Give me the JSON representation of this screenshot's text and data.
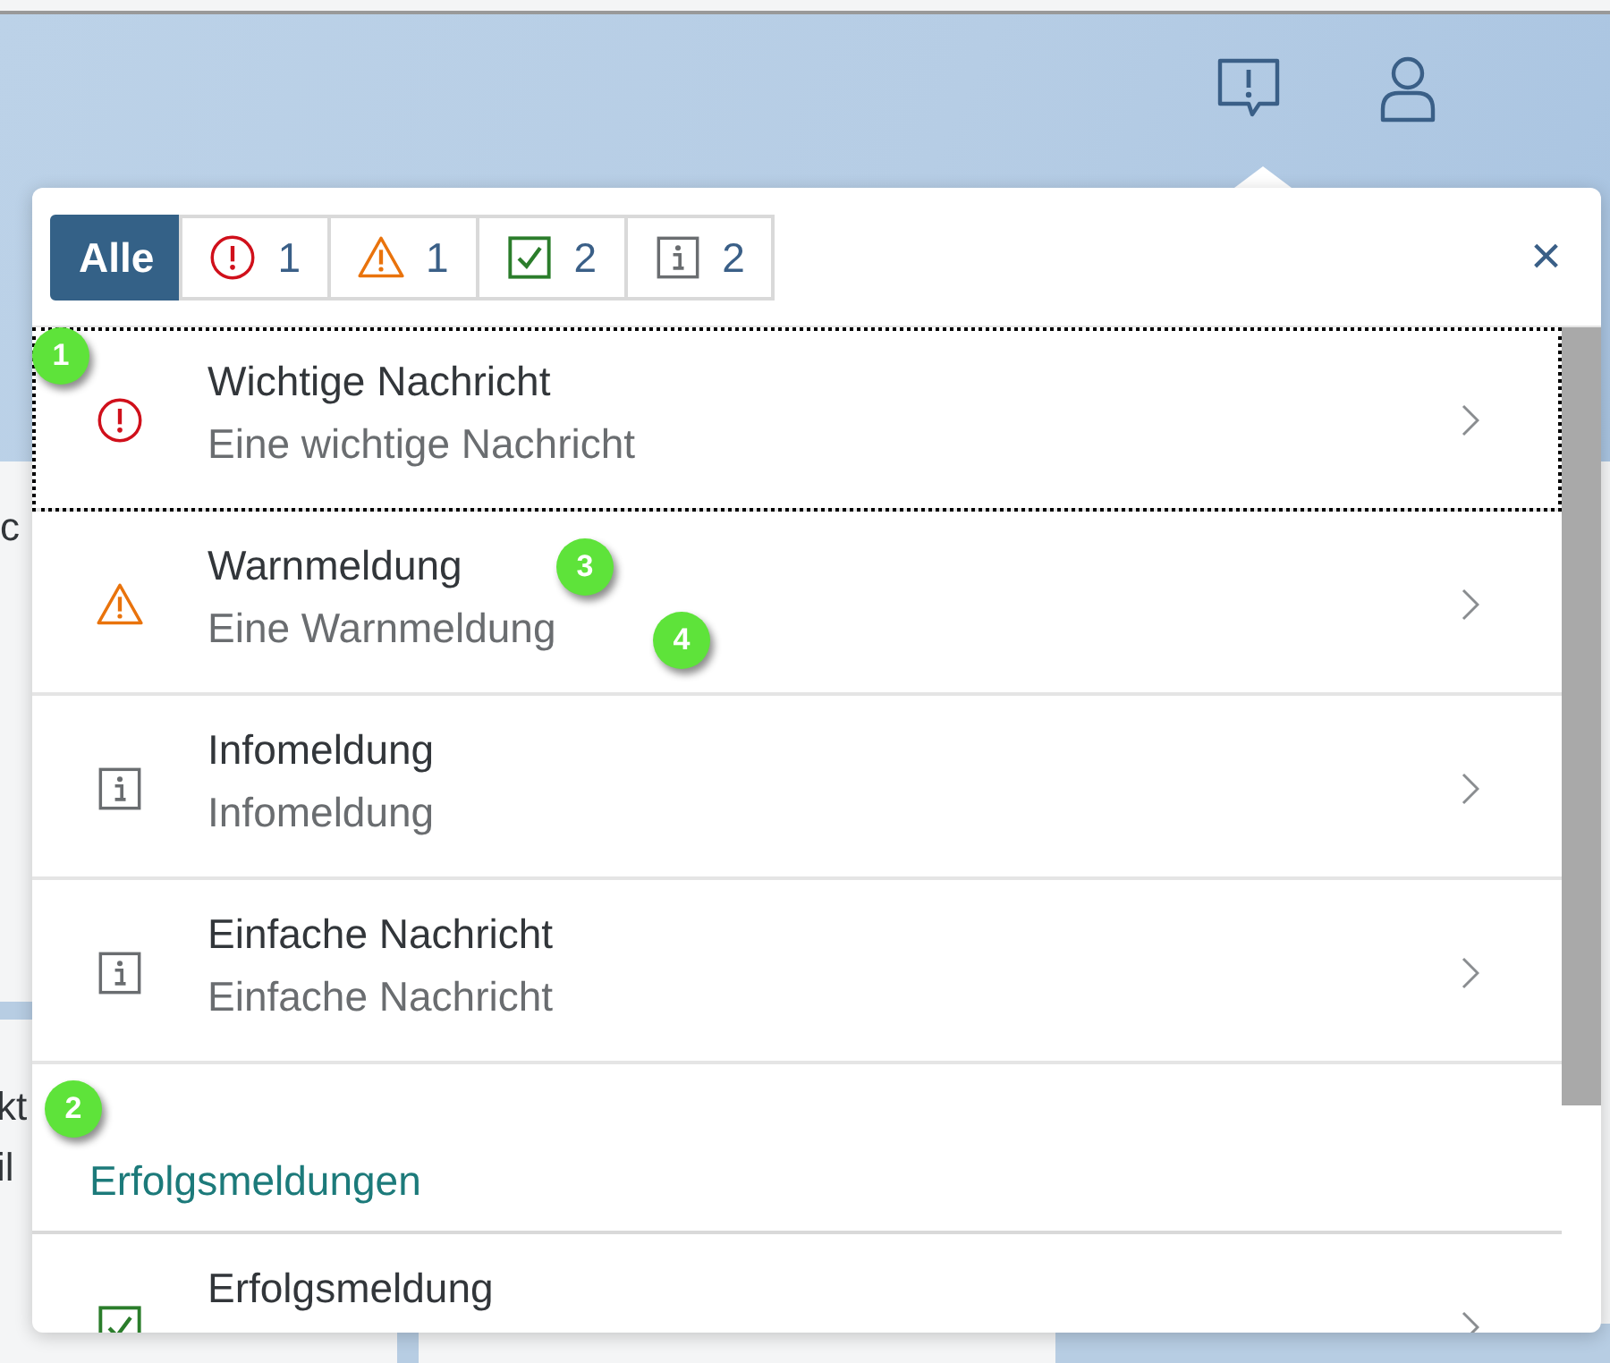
{
  "background_fragments": [
    {
      "text": "c"
    },
    {
      "text": "kt"
    },
    {
      "text": "il"
    }
  ],
  "filters": [
    {
      "kind": "all",
      "label": "Alle",
      "selected": true
    },
    {
      "kind": "error",
      "count": "1",
      "selected": false
    },
    {
      "kind": "warning",
      "count": "1",
      "selected": false
    },
    {
      "kind": "success",
      "count": "2",
      "selected": false
    },
    {
      "kind": "information",
      "count": "2",
      "selected": false
    }
  ],
  "close_label": "×",
  "list": [
    {
      "kind": "error",
      "title": "Wichtige Nachricht",
      "subtitle": "Eine wichtige Nachricht",
      "focused": true
    },
    {
      "kind": "warning",
      "title": "Warnmeldung",
      "subtitle": "Eine Warnmeldung",
      "focused": false
    },
    {
      "kind": "information",
      "title": "Infomeldung",
      "subtitle": "Infomeldung",
      "focused": false
    },
    {
      "kind": "information",
      "title": "Einfache Nachricht",
      "subtitle": "Einfache Nachricht",
      "focused": false
    },
    {
      "kind": "group",
      "title": "Erfolgsmeldungen"
    },
    {
      "kind": "success",
      "title": "Erfolgsmeldung",
      "focused": false
    }
  ],
  "callouts": [
    {
      "label": "1"
    },
    {
      "label": "2"
    },
    {
      "label": "3"
    },
    {
      "label": "4"
    }
  ]
}
